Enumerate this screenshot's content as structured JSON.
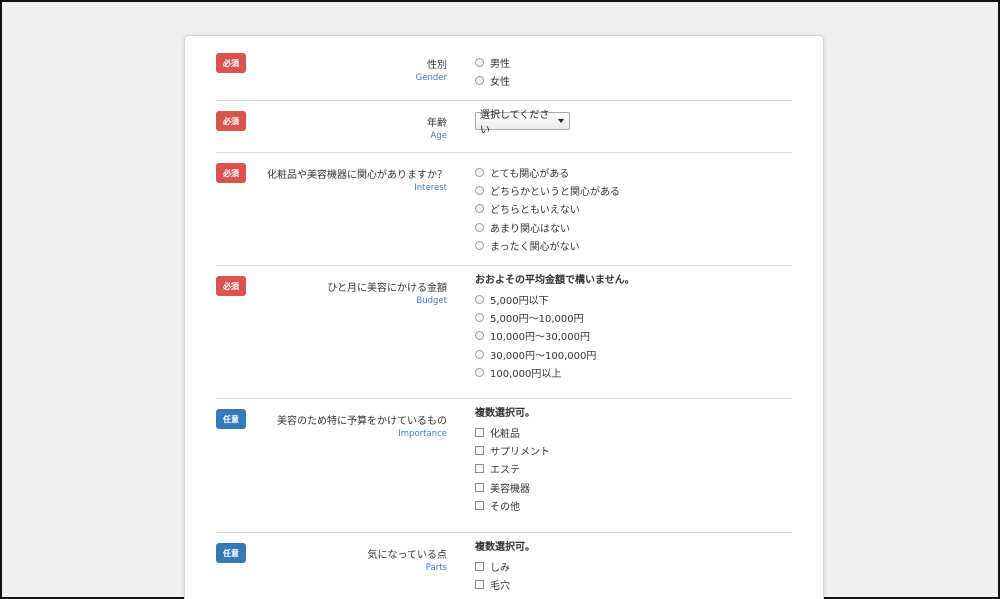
{
  "rows": [
    {
      "badge": "必須",
      "label_ja": "性別",
      "label_en": "Gender",
      "type": "radio",
      "options": [
        "男性",
        "女性"
      ]
    },
    {
      "badge": "必須",
      "label_ja": "年齢",
      "label_en": "Age",
      "type": "select",
      "selected": "選択してください"
    },
    {
      "badge": "必須",
      "label_ja": "化粧品や美容機器に関心がありますか？",
      "label_en": "Interest",
      "type": "radio",
      "options": [
        "とても関心がある",
        "どちらかというと関心がある",
        "どちらともいえない",
        "あまり関心はない",
        "まったく関心がない"
      ]
    },
    {
      "badge": "必須",
      "label_ja": "ひと月に美容にかける金額",
      "label_en": "Budget",
      "note": "おおよその平均金額で構いません。",
      "type": "radio",
      "options": [
        "5,000円以下",
        "5,000円〜10,000円",
        "10,000円〜30,000円",
        "30,000円〜100,000円",
        "100,000円以上"
      ]
    },
    {
      "badge": "任意",
      "label_ja": "美容のため特に予算をかけているもの",
      "label_en": "Importance",
      "note": "複数選択可。",
      "type": "checkbox",
      "options": [
        "化粧品",
        "サプリメント",
        "エステ",
        "美容機器",
        "その他"
      ]
    },
    {
      "badge": "任意",
      "label_ja": "気になっている点",
      "label_en": "Parts",
      "note": "複数選択可。",
      "type": "checkbox",
      "options": [
        "しみ",
        "毛穴"
      ]
    }
  ],
  "colors": {
    "required": "#d9534f",
    "optional": "#337ab7",
    "label_en": "#3a7bd5"
  }
}
